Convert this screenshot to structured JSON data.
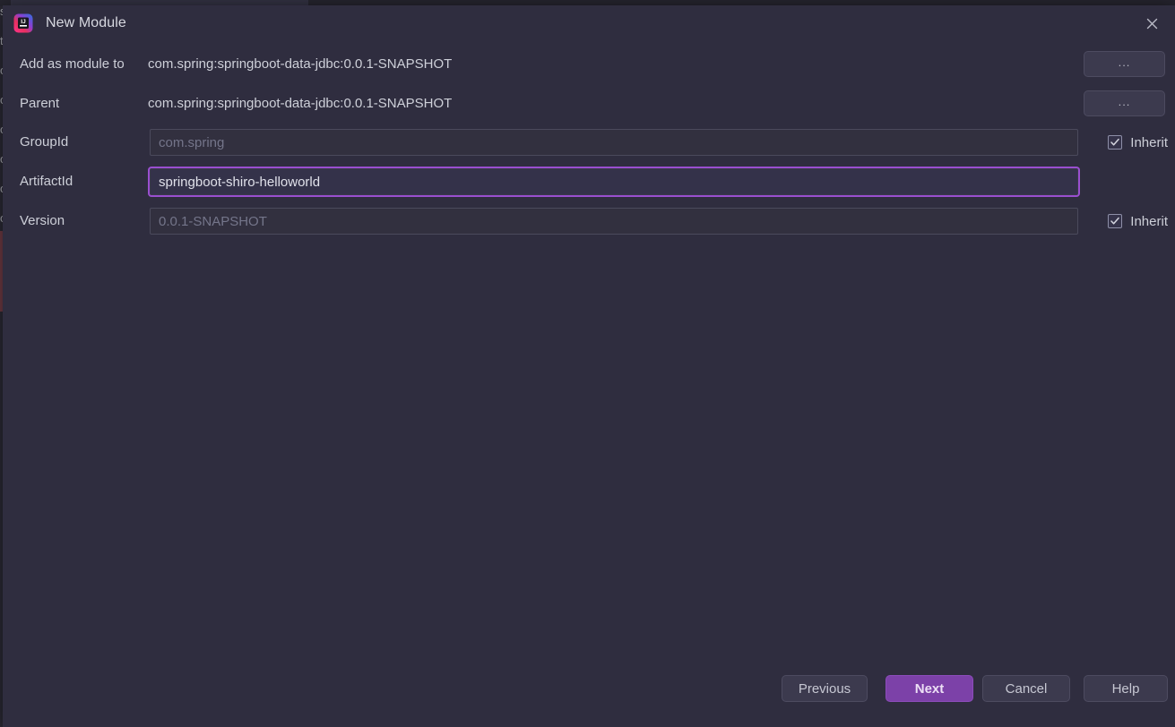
{
  "window": {
    "title": "New Module",
    "app_icon": "intellij-idea-icon",
    "close_icon": "close-icon"
  },
  "form": {
    "rows": [
      {
        "label": "Add as module to",
        "type": "static",
        "value": "com.spring:springboot-data-jdbc:0.0.1-SNAPSHOT",
        "browse_label": "...",
        "name": "add-as-module-to"
      },
      {
        "label": "Parent",
        "type": "static",
        "value": "com.spring:springboot-data-jdbc:0.0.1-SNAPSHOT",
        "browse_label": "...",
        "name": "parent"
      },
      {
        "label": "GroupId",
        "type": "input",
        "value": "",
        "placeholder": "com.spring",
        "focused": false,
        "inherit_label": "Inherit",
        "inherit_checked": true,
        "name": "group-id"
      },
      {
        "label": "ArtifactId",
        "type": "input",
        "value": "springboot-shiro-helloworld",
        "placeholder": "",
        "focused": true,
        "name": "artifact-id"
      },
      {
        "label": "Version",
        "type": "input",
        "value": "",
        "placeholder": "0.0.1-SNAPSHOT",
        "focused": false,
        "inherit_label": "Inherit",
        "inherit_checked": true,
        "name": "version"
      }
    ]
  },
  "footer": {
    "previous_label": "Previous",
    "next_label": "Next",
    "cancel_label": "Cancel",
    "help_label": "Help"
  },
  "colors": {
    "dialog_background": "#2f2d3f",
    "field_background": "#32303f",
    "focus_accent": "#9a4fd0",
    "primary_button": "#7c41a8",
    "text_primary": "#cdcfd8",
    "text_placeholder": "#74758a"
  },
  "backdrop": {
    "sliver_text": [
      "s",
      "t",
      "o",
      "o",
      "o",
      "o",
      "o",
      "o",
      "o",
      "r",
      "n"
    ]
  }
}
